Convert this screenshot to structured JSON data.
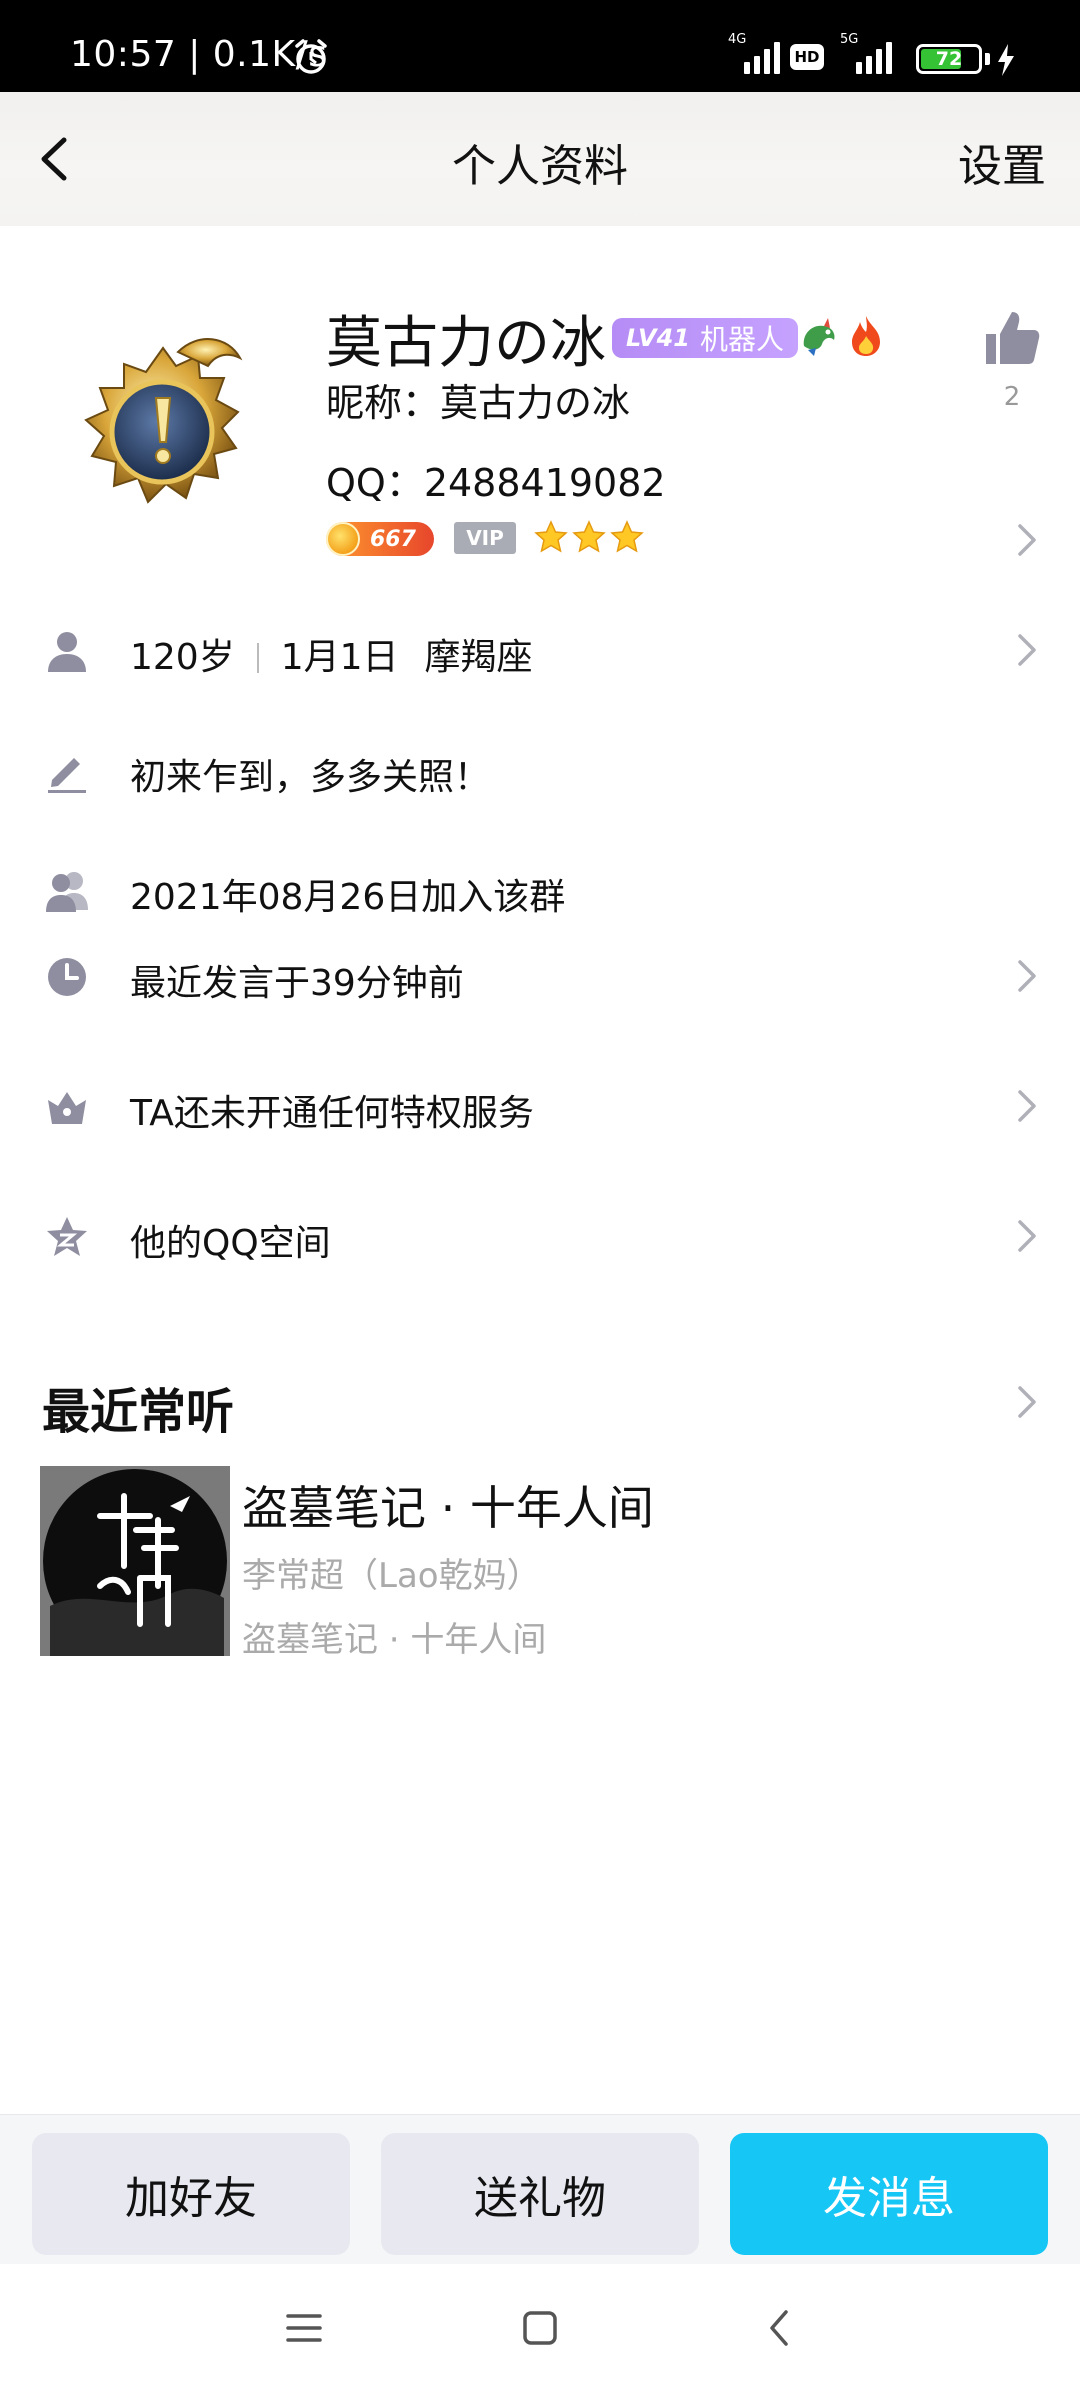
{
  "status_bar": {
    "time": "10:57 | 0.1K/s",
    "network_1": "4G",
    "network_2": "5G",
    "hd": "HD",
    "battery": "72"
  },
  "header": {
    "title": "个人资料",
    "settings": "设置"
  },
  "profile": {
    "name": "莫古力の冰",
    "level": "LV41",
    "badge_text": "机器人",
    "nickname": "昵称：莫古力の冰",
    "qq": "QQ：2488419082",
    "coin_value": "667",
    "vip": "VIP",
    "star_count": 3,
    "likes": "2"
  },
  "info_rows": {
    "age": "120岁",
    "birthday": "1月1日",
    "zodiac": "摩羯座",
    "signature": "初来乍到，多多关照！",
    "joined": "2021年08月26日加入该群",
    "last_spoke": "最近发言于39分钟前",
    "privilege": "TA还未开通任何特权服务",
    "qzone": "他的QQ空间"
  },
  "recent_music": {
    "section_title": "最近常听",
    "song_title": "盗墓笔记 · 十年人间",
    "artist": "李常超（Lao乾妈）",
    "album": "盗墓笔记 · 十年人间"
  },
  "actions": {
    "add_friend": "加好友",
    "send_gift": "送礼物",
    "send_message": "发消息"
  },
  "colors": {
    "primary": "#16c6f5",
    "level_badge": "#b58cf5",
    "icon_gray": "#8e8ea0"
  }
}
